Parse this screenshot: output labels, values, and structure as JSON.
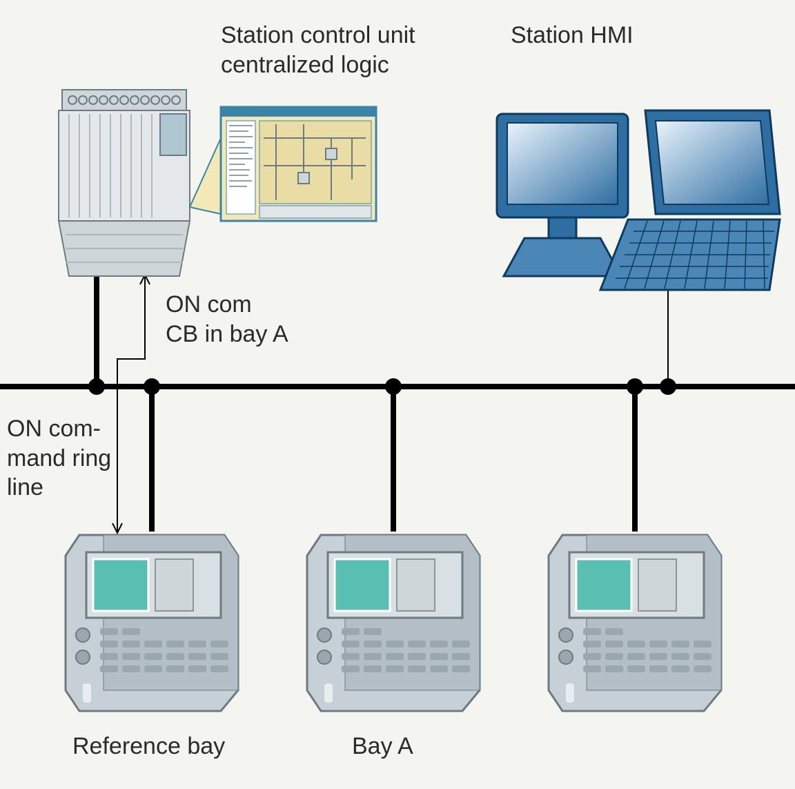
{
  "labels": {
    "station_control": "Station control unit\ncentralized logic",
    "station_hmi": "Station HMI",
    "on_com_cb": "ON com\nCB in bay A",
    "on_cmd_ring": "ON com-\nmand ring\nline",
    "reference_bay": "Reference bay",
    "bay_a": "Bay A"
  },
  "nodes": {
    "plc": "station-control-plc",
    "logic_editor": "centralized-logic-editor",
    "hmi_monitor": "station-hmi-monitor",
    "hmi_laptop": "station-hmi-laptop",
    "ied_ref": "reference-bay-ied",
    "ied_bay_a": "bay-a-ied",
    "ied_right": "right-bay-ied"
  }
}
